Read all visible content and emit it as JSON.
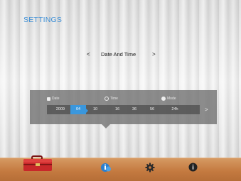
{
  "screen_title": "SETTINGS",
  "nav": {
    "prev": "<",
    "label": "Date And Time",
    "next": ">"
  },
  "panel": {
    "headers": {
      "date": "Date",
      "time": "Time",
      "mode": "Mode"
    },
    "values": {
      "year": "2009",
      "month": "04",
      "day": "10",
      "hour": "16",
      "minute": "36",
      "second": "56",
      "mode": "24h"
    },
    "selected_field": "month",
    "next_arrow": ">"
  },
  "dock": {
    "items": [
      "toolbox-icon",
      "info-bubble-icon",
      "gear-icon",
      "info-icon"
    ]
  },
  "colors": {
    "accent": "#3a97dd",
    "title": "#3d8fd6",
    "dock": "#c47a40",
    "toolbox": "#c8282a"
  }
}
